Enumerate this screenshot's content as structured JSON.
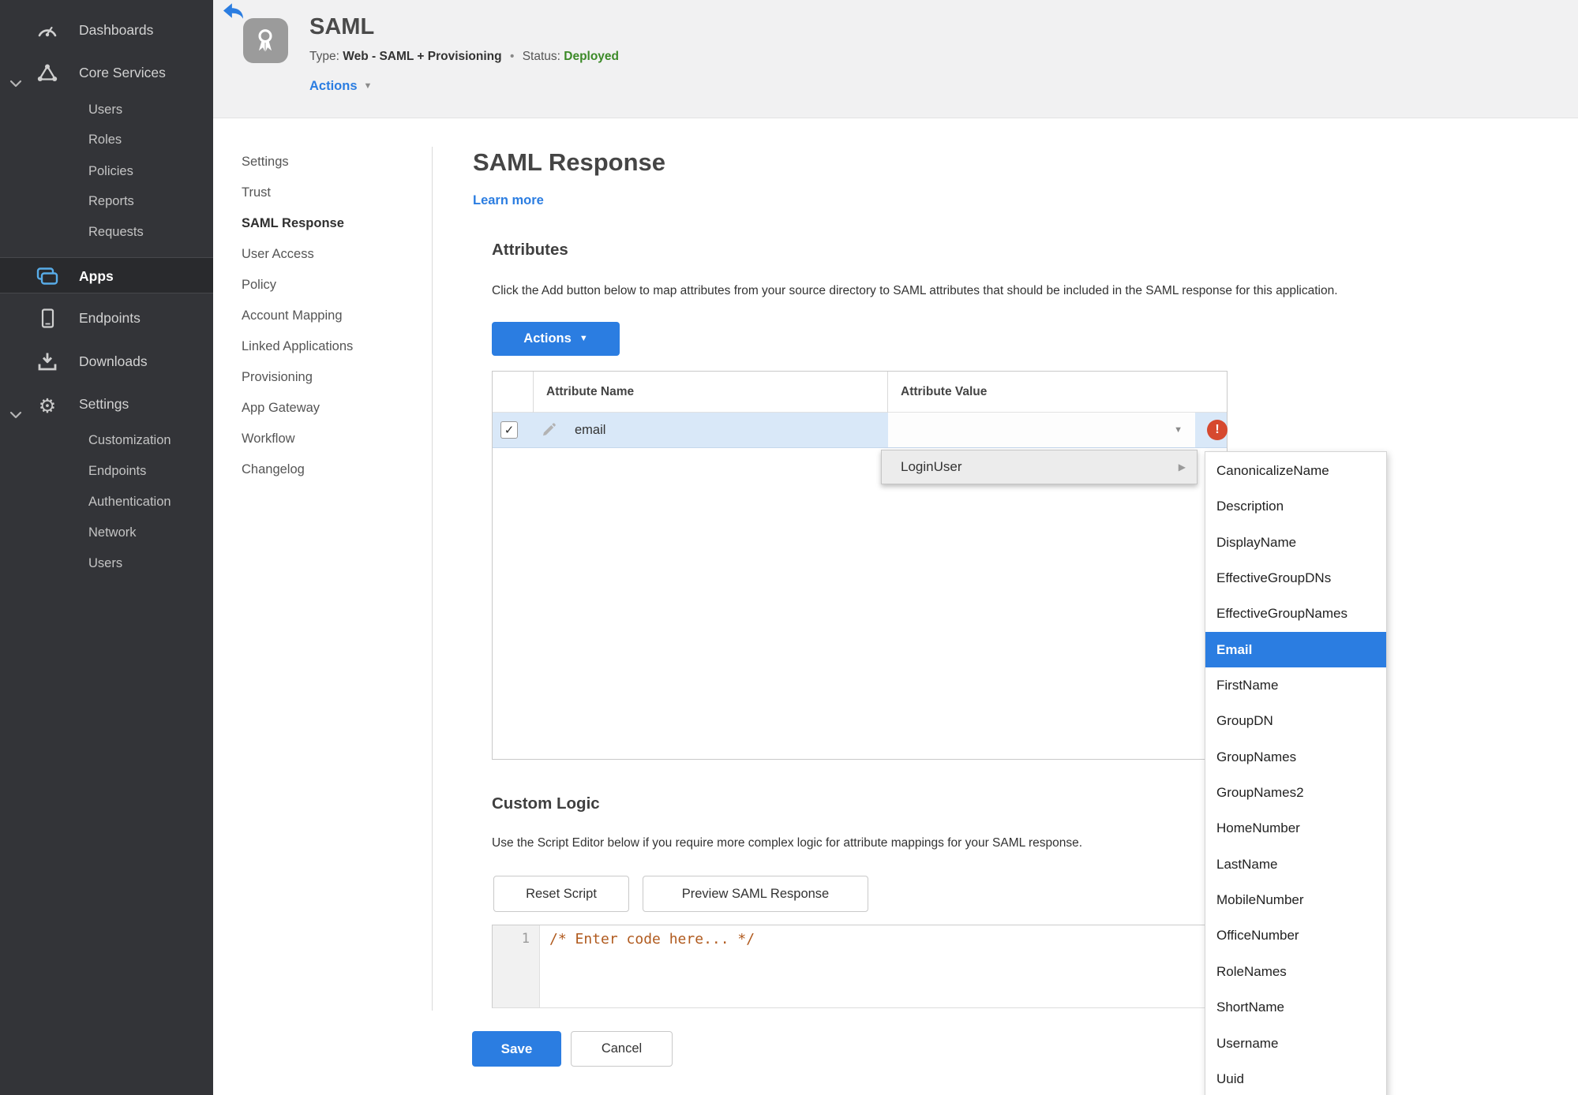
{
  "sidebar": {
    "dashboards": "Dashboards",
    "core_services": "Core Services",
    "core_items": [
      "Users",
      "Roles",
      "Policies",
      "Reports",
      "Requests"
    ],
    "apps": "Apps",
    "endpoints": "Endpoints",
    "downloads": "Downloads",
    "settings": "Settings",
    "settings_items": [
      "Customization",
      "Endpoints",
      "Authentication",
      "Network",
      "Users"
    ]
  },
  "header": {
    "title": "SAML",
    "type_label": "Type:",
    "type_value": "Web - SAML + Provisioning",
    "dot": "•",
    "status_label": "Status:",
    "status_value": "Deployed",
    "actions": "Actions"
  },
  "subnav": {
    "items": [
      "Settings",
      "Trust",
      "SAML Response",
      "User Access",
      "Policy",
      "Account Mapping",
      "Linked Applications",
      "Provisioning",
      "App Gateway",
      "Workflow",
      "Changelog"
    ],
    "active": "SAML Response"
  },
  "main": {
    "title": "SAML Response",
    "learn_more": "Learn more",
    "attributes_heading": "Attributes",
    "attributes_description": "Click the Add button below to map attributes from your source directory to SAML attributes that should be included in the SAML response for this application.",
    "actions_button": "Actions",
    "table": {
      "col_name": "Attribute Name",
      "col_value": "Attribute Value",
      "row": {
        "name": "email",
        "value": "",
        "checked": true,
        "error": true
      }
    },
    "menu": {
      "label": "LoginUser"
    },
    "submenu": {
      "items": [
        "CanonicalizeName",
        "Description",
        "DisplayName",
        "EffectiveGroupDNs",
        "EffectiveGroupNames",
        "Email",
        "FirstName",
        "GroupDN",
        "GroupNames",
        "GroupNames2",
        "HomeNumber",
        "LastName",
        "MobileNumber",
        "OfficeNumber",
        "RoleNames",
        "ShortName",
        "Username",
        "Uuid"
      ],
      "selected": "Email"
    },
    "custom_logic_heading": "Custom Logic",
    "custom_logic_description": "Use the Script Editor below if you require more complex logic for attribute mappings for your SAML response.",
    "reset_button": "Reset Script",
    "preview_button": "Preview SAML Response",
    "editor": {
      "line_number": "1",
      "code": "/* Enter code here... */"
    },
    "save": "Save",
    "cancel": "Cancel"
  },
  "icons": {
    "caret_down": "▼",
    "caret_right": "▶",
    "check": "✓",
    "error": "!",
    "gear": "⚙"
  },
  "colors": {
    "accent": "#2b7de1",
    "status_green": "#3c8a28",
    "error_red": "#d6492f",
    "sidebar_bg": "#333438",
    "row_highlight": "#d9e8f8",
    "apps_icon_blue": "#58ace8"
  }
}
